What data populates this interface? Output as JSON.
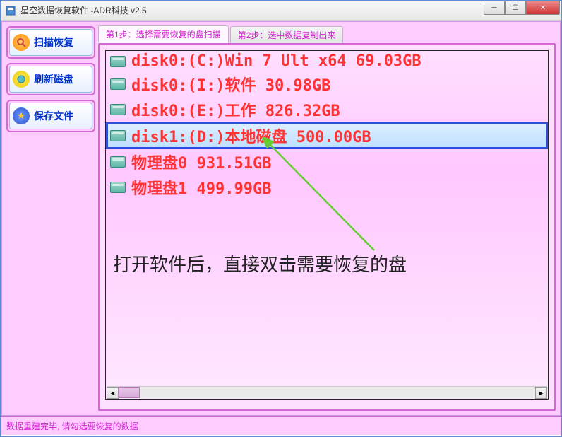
{
  "window": {
    "title": "星空数据恢复软件   -ADR科技 v2.5"
  },
  "sidebar": {
    "buttons": [
      {
        "label": "扫描恢复",
        "icon": "scan"
      },
      {
        "label": "刷新磁盘",
        "icon": "refresh"
      },
      {
        "label": "保存文件",
        "icon": "save"
      }
    ]
  },
  "tabs": [
    {
      "label": "第1步：选择需要恢复的盘扫描",
      "active": true
    },
    {
      "label": "第2步：选中数据复制出来",
      "active": false
    }
  ],
  "disks": [
    {
      "text": "disk0:(C:)Win 7 Ult x64 69.03GB",
      "selected": false
    },
    {
      "text": "disk0:(I:)软件 30.98GB",
      "selected": false
    },
    {
      "text": "disk0:(E:)工作 826.32GB",
      "selected": false
    },
    {
      "text": "disk1:(D:)本地磁盘 500.00GB",
      "selected": true
    },
    {
      "text": "物理盘0 931.51GB",
      "selected": false
    },
    {
      "text": "物理盘1 499.99GB",
      "selected": false
    }
  ],
  "instruction": "打开软件后，直接双击需要恢复的盘",
  "statusbar": "数据重建完毕, 请勾选要恢复的数据"
}
